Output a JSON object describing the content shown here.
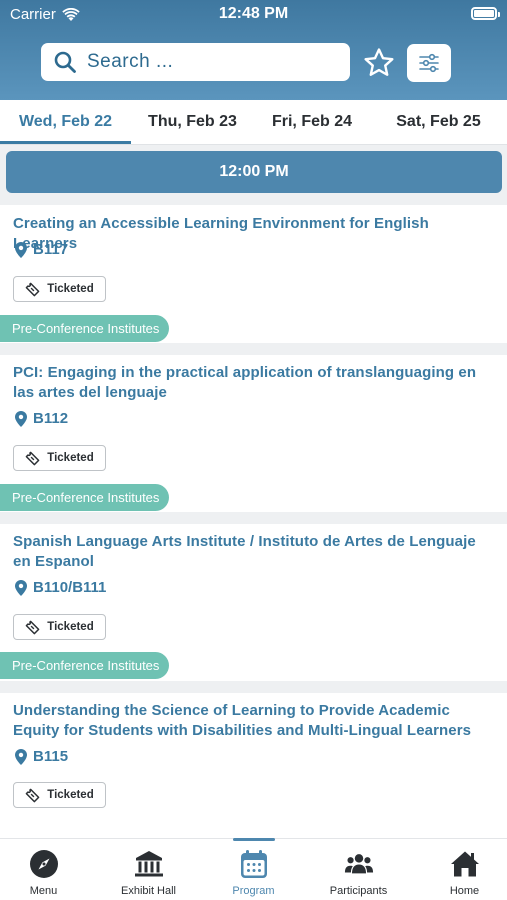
{
  "status_bar": {
    "carrier": "Carrier",
    "time": "12:48 PM"
  },
  "search": {
    "placeholder": "Search ..."
  },
  "tabs": [
    {
      "label": "Wed, Feb 22",
      "active": true
    },
    {
      "label": "Thu, Feb 23",
      "active": false
    },
    {
      "label": "Fri, Feb 24",
      "active": false
    },
    {
      "label": "Sat, Feb 25",
      "active": false
    }
  ],
  "time_header": "12:00 PM",
  "sessions": [
    {
      "title": "Creating an Accessible Learning Environment for English Learners",
      "location": "B117",
      "ticket_label": "Ticketed",
      "track": "Pre-Conference Institutes"
    },
    {
      "title": "PCI:  Engaging in the practical application of translanguaging en las artes del lenguaje",
      "location": "B112",
      "ticket_label": "Ticketed",
      "track": "Pre-Conference Institutes"
    },
    {
      "title": "Spanish Language Arts Institute / Instituto de Artes de Lenguaje en Espanol",
      "location": "B110/B111",
      "ticket_label": "Ticketed",
      "track": "Pre-Conference Institutes"
    },
    {
      "title": "Understanding the Science of Learning to Provide Academic Equity for Students with Disabilities and Multi-Lingual Learners",
      "location": "B115",
      "ticket_label": "Ticketed"
    }
  ],
  "bottom_nav": [
    {
      "label": "Menu",
      "icon": "compass-icon"
    },
    {
      "label": "Exhibit Hall",
      "icon": "building-columns-icon"
    },
    {
      "label": "Program",
      "icon": "calendar-icon",
      "active": true
    },
    {
      "label": "Participants",
      "icon": "people-icon"
    },
    {
      "label": "Home",
      "icon": "house-icon"
    }
  ],
  "colors": {
    "header": "#4e87ae",
    "accent": "#3b7aa1",
    "track_tag": "#6fc2b3"
  }
}
